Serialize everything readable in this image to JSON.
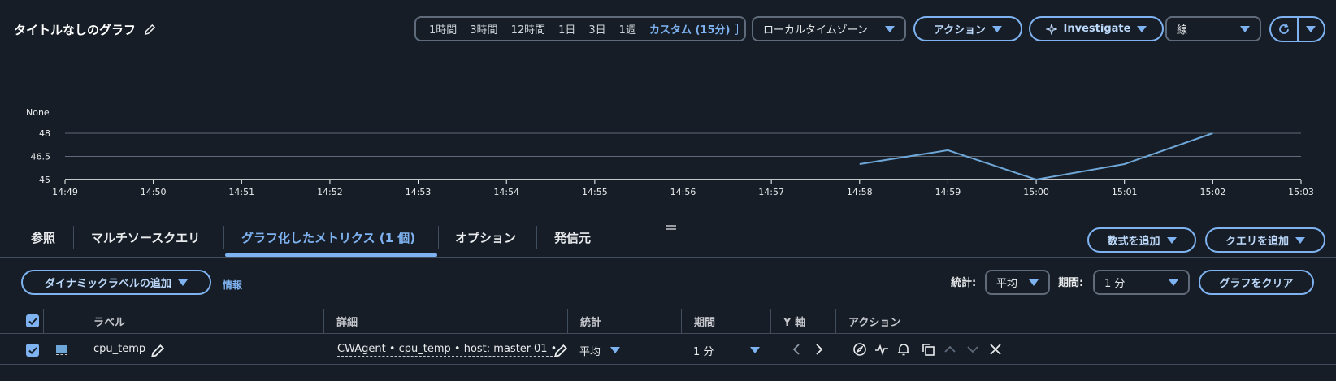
{
  "header": {
    "title": "タイトルなしのグラフ",
    "time_options": [
      "1時間",
      "3時間",
      "12時間",
      "1日",
      "3日",
      "1週"
    ],
    "time_selected": "カスタム (15分)",
    "timezone": "ローカルタイムゾーン",
    "actions_label": "アクション",
    "investigate_label": "Investigate",
    "chart_type": "線"
  },
  "chart_data": {
    "type": "line",
    "ylabel": "None",
    "yticks": [
      "48",
      "46.5",
      "45"
    ],
    "ylim": [
      45,
      48
    ],
    "xticks": [
      "14:49",
      "14:50",
      "14:51",
      "14:52",
      "14:53",
      "14:54",
      "14:55",
      "14:56",
      "14:57",
      "14:58",
      "14:59",
      "15:00",
      "15:01",
      "15:02",
      "15:03"
    ],
    "series": [
      {
        "x": [
          "14:58",
          "14:59",
          "15:00",
          "15:01",
          "15:02"
        ],
        "values": [
          46.0,
          46.9,
          45.0,
          46.0,
          48.0
        ],
        "color": "#6ea6d7"
      }
    ],
    "grid": true
  },
  "tabs": [
    "参照",
    "マルチソースクエリ",
    "グラフ化したメトリクス (1 個)",
    "オプション",
    "発信元"
  ],
  "toolbar": {
    "add_formula": "数式を追加",
    "add_query": "クエリを追加",
    "dynamic_label": "ダイナミックラベルの追加",
    "info": "情報",
    "stat_label": "統計:",
    "stat_value": "平均",
    "period_label": "期間:",
    "period_value": "1 分",
    "clear_graph": "グラフをクリア"
  },
  "table": {
    "headers": [
      "ラベル",
      "詳細",
      "統計",
      "期間",
      "Y 軸",
      "アクション"
    ],
    "rows": [
      {
        "label": "cpu_temp",
        "details": "CWAgent • cpu_temp • host: master-01 •",
        "stat": "平均",
        "period": "1 分",
        "color": "#6ea6d7"
      }
    ]
  },
  "colors": {
    "background": "#161d26",
    "accent": "#7eb2f0",
    "border": "#5f6b7a"
  }
}
